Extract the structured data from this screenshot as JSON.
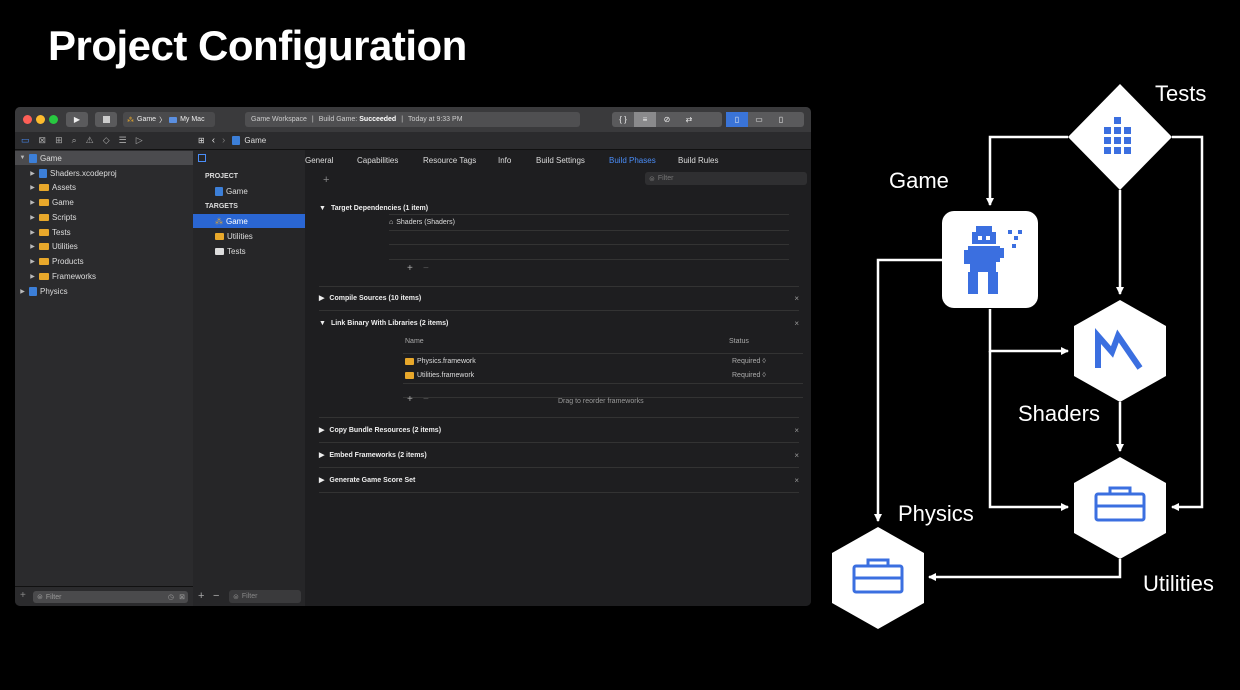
{
  "slide": {
    "title": "Project Configuration"
  },
  "toolbar": {
    "scheme_target": "Game",
    "scheme_device": "My Mac",
    "workspace": "Game Workspace",
    "build_label": "Build Game:",
    "build_status": "Succeeded",
    "build_time": "Today at 9:33 PM",
    "curly": "{ }"
  },
  "jumpbar": {
    "item": "Game"
  },
  "navigator": {
    "items": [
      {
        "label": "Game"
      },
      {
        "label": "Shaders.xcodeproj"
      },
      {
        "label": "Assets"
      },
      {
        "label": "Game"
      },
      {
        "label": "Scripts"
      },
      {
        "label": "Tests"
      },
      {
        "label": "Utilities"
      },
      {
        "label": "Products"
      },
      {
        "label": "Frameworks"
      },
      {
        "label": "Physics"
      }
    ],
    "filter_placeholder": "Filter"
  },
  "targets_panel": {
    "project_header": "PROJECT",
    "project_item": "Game",
    "targets_header": "TARGETS",
    "targets": [
      {
        "label": "Game"
      },
      {
        "label": "Utilities"
      },
      {
        "label": "Tests"
      }
    ],
    "filter_placeholder": "Filter"
  },
  "editor": {
    "tabs": [
      "General",
      "Capabilities",
      "Resource Tags",
      "Info",
      "Build Settings",
      "Build Phases",
      "Build Rules"
    ],
    "active_tab": "Build Phases",
    "filter_placeholder": "Filter",
    "phases": {
      "target_dependencies": "Target Dependencies (1 item)",
      "dependency_item": "Shaders (Shaders)",
      "compile_sources": "Compile Sources (10 items)",
      "link_binary": "Link Binary With Libraries (2 items)",
      "col_name": "Name",
      "col_status": "Status",
      "frameworks": [
        {
          "name": "Physics.framework",
          "status": "Required ◊"
        },
        {
          "name": "Utilities.framework",
          "status": "Required ◊"
        }
      ],
      "drag_hint": "Drag to reorder frameworks",
      "copy_bundle": "Copy Bundle Resources (2 items)",
      "embed_frameworks": "Embed Frameworks (2 items)",
      "game_score": "Generate Game Score Set"
    }
  },
  "diagram": {
    "nodes": {
      "tests": "Tests",
      "game": "Game",
      "shaders": "Shaders",
      "physics": "Physics",
      "utilities": "Utilities"
    },
    "colors": {
      "node_fill": "#ffffff",
      "icon": "#3b6fe0",
      "arrow": "#ffffff"
    }
  }
}
